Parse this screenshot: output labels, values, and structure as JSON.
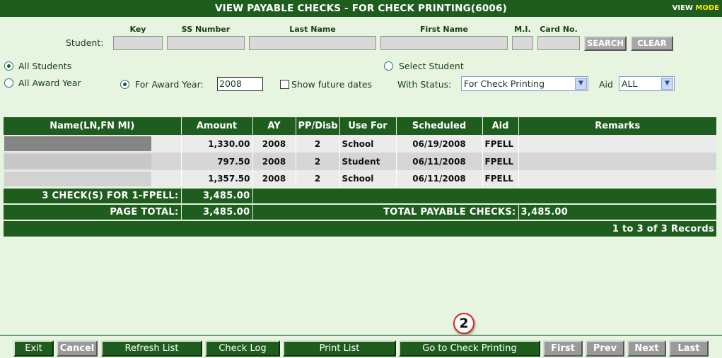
{
  "header": {
    "title": "VIEW PAYABLE CHECKS - FOR CHECK PRINTING(6006)",
    "mode_prefix": "VIEW ",
    "mode_label": "MODE"
  },
  "search": {
    "student_label": "Student:",
    "col_key": "Key",
    "col_ss": "SS Number",
    "col_last": "Last Name",
    "col_first": "First Name",
    "col_mi": "M.I.",
    "col_card": "Card No.",
    "search_button": "SEARCH",
    "clear_button": "CLEAR"
  },
  "filters": {
    "all_students": "All Students",
    "select_student": "Select Student",
    "all_award_year": "All Award Year",
    "for_award_year": "For Award Year:",
    "award_year_value": "2008",
    "show_future": "Show future dates",
    "with_status_label": "With Status:",
    "status_value": "For Check Printing",
    "aid_label": "Aid",
    "aid_value": "ALL"
  },
  "table": {
    "columns": [
      "Name(LN,FN MI)",
      "Amount",
      "AY",
      "PP/Disb",
      "Use For",
      "Scheduled",
      "Aid",
      "Remarks"
    ],
    "rows": [
      {
        "amount": "1,330.00",
        "ay": "2008",
        "pp": "2",
        "use_for": "School",
        "scheduled": "06/19/2008",
        "aid": "FPELL",
        "remarks": ""
      },
      {
        "amount": "797.50",
        "ay": "2008",
        "pp": "2",
        "use_for": "Student",
        "scheduled": "06/11/2008",
        "aid": "FPELL",
        "remarks": ""
      },
      {
        "amount": "1,357.50",
        "ay": "2008",
        "pp": "2",
        "use_for": "School",
        "scheduled": "06/11/2008",
        "aid": "FPELL",
        "remarks": ""
      }
    ],
    "subtotal_label": "3 CHECK(S) FOR 1-FPELL:",
    "subtotal_value": "3,485.00",
    "page_total_label": "PAGE TOTAL:",
    "page_total_value": "3,485.00",
    "total_payable_label": "TOTAL PAYABLE CHECKS:",
    "total_payable_value": "3,485.00",
    "records": "1 to 3 of 3 Records"
  },
  "footer": {
    "exit": "Exit",
    "cancel": "Cancel",
    "refresh": "Refresh List",
    "check_log": "Check Log",
    "print_list": "Print List",
    "go_to_printing": "Go to Check Printing",
    "first": "First",
    "prev": "Prev",
    "next": "Next",
    "last": "Last"
  },
  "callout": {
    "number": "2"
  },
  "colors": {
    "header_green": "#1f5d1f",
    "background": "#e6f4e0",
    "mode_highlight": "#ffe600",
    "callout_ring": "#dd2222"
  }
}
